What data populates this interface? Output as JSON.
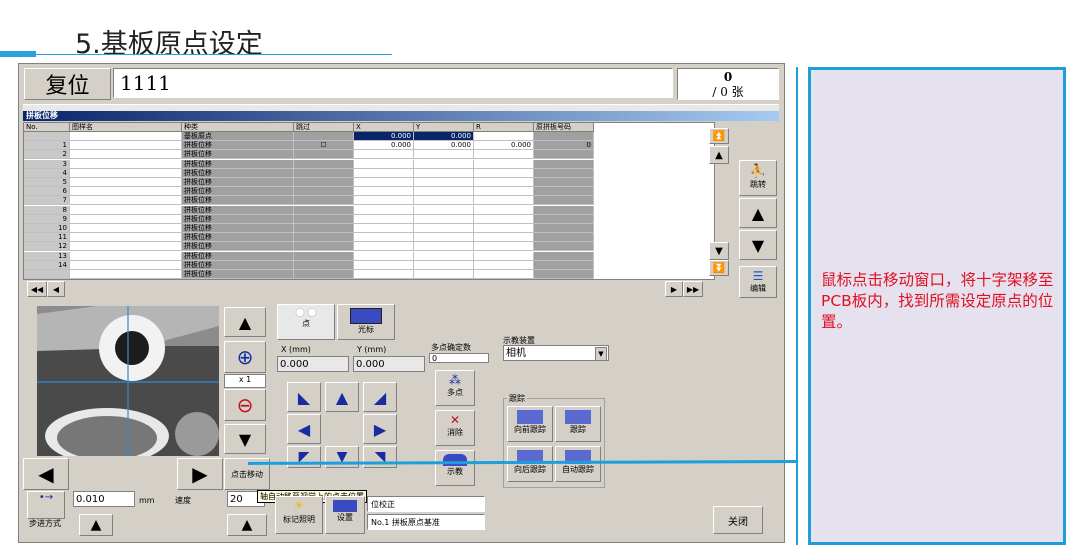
{
  "slide": {
    "title": "5.基板原点设定"
  },
  "top_bar": {
    "reset_label": "复位",
    "field_value": "1111",
    "count_top": "0",
    "count_bottom": "/ 0 张"
  },
  "panel": {
    "title": "拼板位移"
  },
  "grid": {
    "headers": [
      "No.",
      "图样名",
      "种类",
      "跳过",
      "X",
      "Y",
      "R",
      "原拼板号码"
    ],
    "rows": [
      {
        "no": "",
        "kind": "基板原点",
        "skip": "",
        "x": "0.000",
        "y": "0.000",
        "r": "",
        "orig": ""
      },
      {
        "no": "1",
        "kind": "拼板位移",
        "skip": "☐",
        "x": "0.000",
        "y": "0.000",
        "r": "0.000",
        "orig": "0"
      },
      {
        "no": "2",
        "kind": "拼板位移",
        "skip": "",
        "x": "",
        "y": "",
        "r": "",
        "orig": ""
      },
      {
        "no": "3",
        "kind": "拼板位移",
        "skip": "",
        "x": "",
        "y": "",
        "r": "",
        "orig": ""
      },
      {
        "no": "4",
        "kind": "拼板位移",
        "skip": "",
        "x": "",
        "y": "",
        "r": "",
        "orig": ""
      },
      {
        "no": "5",
        "kind": "拼板位移",
        "skip": "",
        "x": "",
        "y": "",
        "r": "",
        "orig": ""
      },
      {
        "no": "6",
        "kind": "拼板位移",
        "skip": "",
        "x": "",
        "y": "",
        "r": "",
        "orig": ""
      },
      {
        "no": "7",
        "kind": "拼板位移",
        "skip": "",
        "x": "",
        "y": "",
        "r": "",
        "orig": ""
      },
      {
        "no": "8",
        "kind": "拼板位移",
        "skip": "",
        "x": "",
        "y": "",
        "r": "",
        "orig": ""
      },
      {
        "no": "9",
        "kind": "拼板位移",
        "skip": "",
        "x": "",
        "y": "",
        "r": "",
        "orig": ""
      },
      {
        "no": "10",
        "kind": "拼板位移",
        "skip": "",
        "x": "",
        "y": "",
        "r": "",
        "orig": ""
      },
      {
        "no": "11",
        "kind": "拼板位移",
        "skip": "",
        "x": "",
        "y": "",
        "r": "",
        "orig": ""
      },
      {
        "no": "12",
        "kind": "拼板位移",
        "skip": "",
        "x": "",
        "y": "",
        "r": "",
        "orig": ""
      },
      {
        "no": "13",
        "kind": "拼板位移",
        "skip": "",
        "x": "",
        "y": "",
        "r": "",
        "orig": ""
      },
      {
        "no": "14",
        "kind": "拼板位移",
        "skip": "",
        "x": "",
        "y": "",
        "r": "",
        "orig": ""
      },
      {
        "no": "",
        "kind": "拼板位移",
        "skip": "",
        "x": "",
        "y": "",
        "r": "",
        "orig": ""
      }
    ]
  },
  "side_buttons": {
    "jump_label": "跳转",
    "edit_label": "编辑"
  },
  "tabs": {
    "point_label": "点",
    "cursor_label": "光标"
  },
  "coords": {
    "x_label": "X (mm)",
    "y_label": "Y (mm)",
    "x_value": "0.000",
    "y_value": "0.000",
    "multi_label": "多点确定数",
    "multi_value": "0"
  },
  "zoom": {
    "factor": "x 1"
  },
  "teach": {
    "device_label": "示教装置",
    "device_value": "相机",
    "multi_btn": "多点",
    "clear_btn": "消除",
    "teach_btn": "示教"
  },
  "tracking": {
    "group_label": "跟踪",
    "forward": "向前跟踪",
    "track": "跟踪",
    "backward": "向后跟踪",
    "auto": "自动跟踪"
  },
  "bottom": {
    "click_move": "点击移动",
    "step_value": "0.010",
    "step_unit": "mm",
    "speed_label": "速度",
    "speed_value": "20",
    "step_mode": "步进方式",
    "mark_light": "标记照明",
    "settings": "设置",
    "correction": "位校正",
    "status": "No.1 拼板原点基准",
    "close": "关闭",
    "tooltip": "轴自动移至视觉上的点击位置"
  },
  "callout": {
    "text": "鼠标点击移动窗口，将十字架移至PCB板内，找到所需设定原点的位置。"
  },
  "colors": {
    "accent": "#1e9fdb",
    "callout_bg": "#e6e1ef",
    "callout_text": "#e01020",
    "selection": "#0a246a"
  }
}
